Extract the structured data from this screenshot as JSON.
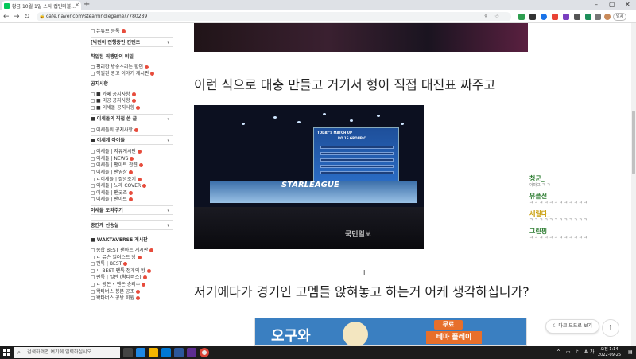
{
  "browser": {
    "tab_title": "황금 10월 1일 스타 캡틴마블...",
    "url": "cafe.naver.com/steamindiegame/7780289",
    "profile_label": "일시"
  },
  "sidebar": {
    "items": [
      {
        "label": "뉴튜브 등록",
        "type": "item"
      },
      {
        "label": "[박진이 진행중인 컨텐츠",
        "type": "section"
      },
      {
        "label": "착일된 취행만의 비밀",
        "type": "section-plain"
      },
      {
        "label": "편리한 방송소리는 할인",
        "type": "item"
      },
      {
        "label": "작일된 광고 이야기 게시판",
        "type": "item"
      },
      {
        "label": "공지사항",
        "type": "section-plain"
      },
      {
        "label": "■ 카페 공지사항",
        "type": "item"
      },
      {
        "label": "■ 미공 공지사항",
        "type": "item"
      },
      {
        "label": "■ 이세돌 공지사항",
        "type": "item"
      },
      {
        "label": "■ 이세돌의 직접 쓴 글",
        "type": "section"
      },
      {
        "label": "이세돌의 공지사항",
        "type": "item"
      },
      {
        "label": "■ 이세계 아이돌",
        "type": "section"
      },
      {
        "label": "이세돌 | 자유게시판",
        "type": "item"
      },
      {
        "label": "이세돌 | NEWS",
        "type": "item"
      },
      {
        "label": "이세돌 | 팬아트 관련",
        "type": "item"
      },
      {
        "label": "이세돌 | 팬영상",
        "type": "item"
      },
      {
        "label": "ㄴ이세돌 | 짤방조기",
        "type": "item"
      },
      {
        "label": "이세돌 | 노래 COVER",
        "type": "item"
      },
      {
        "label": "이세돌 | 팬굿즈",
        "type": "item"
      },
      {
        "label": "이세돌 | 팬아트",
        "type": "item"
      },
      {
        "label": "이세돌 도와주기",
        "type": "section"
      },
      {
        "label": "중간계 신송실",
        "type": "section"
      },
      {
        "label": "■ WAKTAVERSE 게시판",
        "type": "section-plain"
      },
      {
        "label": "종합 BEST 팬아트 게시판",
        "type": "item"
      },
      {
        "label": "ㄴ 뮤슨 일러스트 방",
        "type": "item"
      },
      {
        "label": "팬톡 | BEST",
        "type": "item"
      },
      {
        "label": "ㄴ BEST 팬톡 정개의 방",
        "type": "item"
      },
      {
        "label": "팬톡 | 일반 (왁타버스)",
        "type": "item"
      },
      {
        "label": "ㄴ 왕돈 • 팬돈 승리수",
        "type": "item"
      },
      {
        "label": "왁타버스 봉본 공조",
        "type": "item"
      },
      {
        "label": "왁타버스 공방 회원",
        "type": "item"
      }
    ]
  },
  "post": {
    "line1": "이런 식으로 대충 만들고 거기서 형이 직접 대진표 짜주고",
    "line2": "저기에다가 경기인 고멤들 앉혀놓고 하는거 어케 생각하십니가?",
    "photo_screen_title": "TODAY'S MATCH UP",
    "photo_group": "RO.16 GROUP C",
    "photo_logo": "STARLEAGUE",
    "photo_watermark": "국민일보",
    "ad_text": "오구와",
    "ad_badge": "무료",
    "ad_badge2": "테마 플레이"
  },
  "chat": [
    {
      "name": "청군_",
      "msg": "아마그 ㅋ ㅋ",
      "color": "#2e7d32"
    },
    {
      "name": "뮤플선",
      "msg": "ㅋ ㅋ ㅋ ㅋ ㅋ ㅋ ㅋ ㅋ ㅋ ㅋ ㅋ ㅋ",
      "color": "#2e7d32"
    },
    {
      "name": "세릴다_",
      "msg": "ㅋ ㅋ ㅋ ㅋ ㅋ ㅋ ㅋ ㅋ ㅋ ㅋ ㅋ ㅋ",
      "color": "#c79a00"
    },
    {
      "name": "그린핑",
      "msg": "ㅋ ㅋ ㅋ ㅋ ㅋ ㅋ ㅋ ㅋ ㅋ ㅋ ㅋ ㅋ",
      "color": "#2e7d32"
    }
  ],
  "buttons": {
    "darkmode": "다크 모드로 보기",
    "totop": "↑"
  },
  "taskbar": {
    "search_placeholder": "검색하려면 여기에 입력하십시오.",
    "time": "오전 1:14",
    "date": "2022-09-25",
    "lang": "A",
    "ime": "가"
  },
  "icons": {
    "back": "←",
    "forward": "→",
    "reload": "↻",
    "newtab": "+"
  }
}
